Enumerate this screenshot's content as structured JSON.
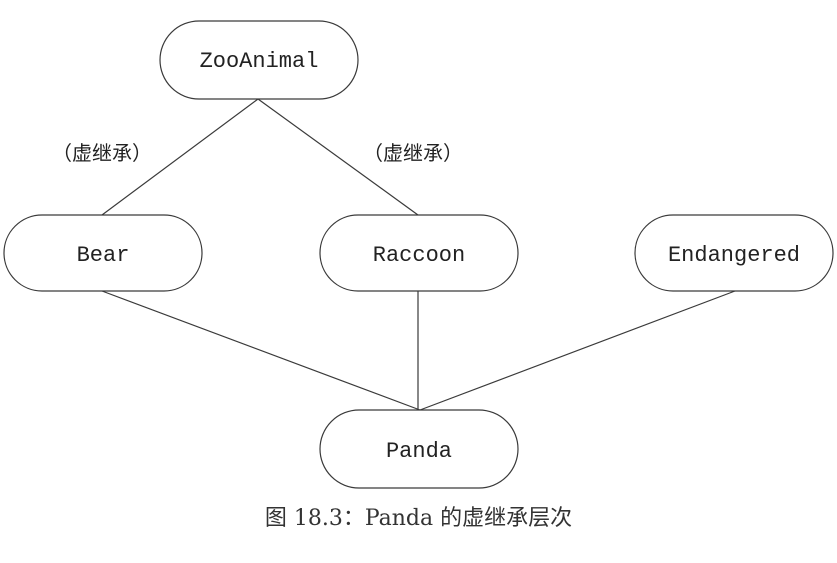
{
  "nodes": {
    "zooanimal": "ZooAnimal",
    "bear": "Bear",
    "raccoon": "Raccoon",
    "endangered": "Endangered",
    "panda": "Panda"
  },
  "edge_labels": {
    "bear_virtual": "（虚继承）",
    "raccoon_virtual": "（虚继承）"
  },
  "caption": "图 18.3：Panda 的虚继承层次",
  "colors": {
    "stroke": "#3a3a3a",
    "text": "#222222",
    "background": "#ffffff"
  }
}
